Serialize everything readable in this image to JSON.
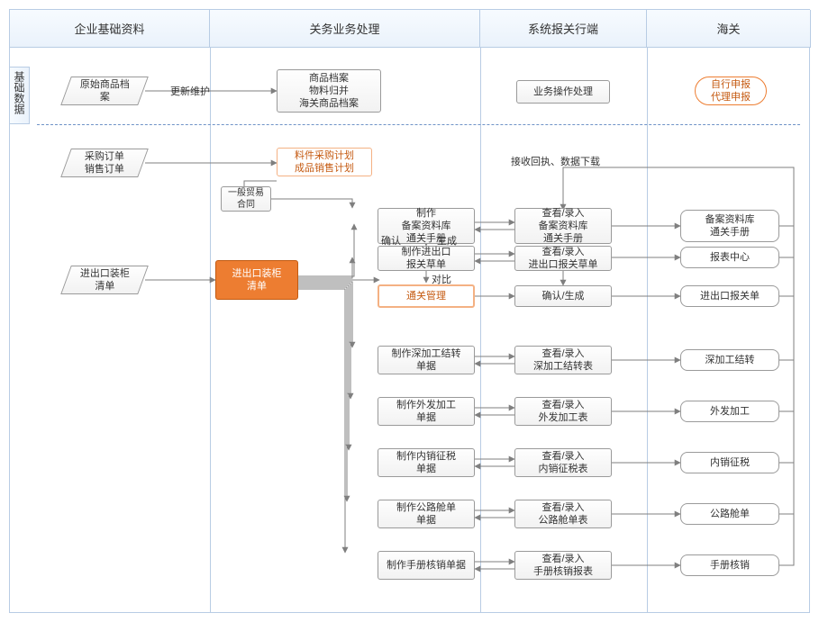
{
  "columns": [
    "企业基础资料",
    "关务业务处理",
    "系统报关行端",
    "海关"
  ],
  "row_label": "基础数据",
  "dash_note": "",
  "nodes": {
    "p_raw": "原始商品档\n案",
    "p_orders": "采购订单\n销售订单",
    "p_cont": "进出口装柜\n清单",
    "l_update": "更新维护",
    "b_archive": "商品档案\n物料归并\n海关商品档案",
    "b_ops": "业务操作处理",
    "pill": "自行申报\n代理申报",
    "o_plan": "料件采购计划\n成品销售计划",
    "b_trade": "一般贸易\n合同",
    "l_confirm": "确认",
    "l_gen": "生成",
    "l_compare": "对比",
    "l_recv": "接收回执、数据下载",
    "o_list": "进出口装柜\n清单",
    "m1": "制作\n备案资料库\n通关手册",
    "o_mg": "通关管理",
    "m2": "制作进出口\n报关草单",
    "m3": "制作深加工结转\n单据",
    "m4": "制作外发加工\n单据",
    "m5": "制作内销征税\n单据",
    "m6": "制作公路舱单\n单据",
    "m7": "制作手册核销单据",
    "r1": "查看/录入\n备案资料库\n通关手册",
    "r2": "查看/录入\n进出口报关草单",
    "r2b": "确认/生成",
    "r3": "查看/录入\n深加工结转表",
    "r4": "查看/录入\n外发加工表",
    "r5": "查看/录入\n内销征税表",
    "r6": "查看/录入\n公路舱单表",
    "r7": "查看/录入\n手册核销报表",
    "h1": "备案资料库\n通关手册",
    "h2": "报表中心",
    "h3": "进出口报关单",
    "h4": "深加工结转",
    "h5": "外发加工",
    "h6": "内销征税",
    "h7": "公路舱单",
    "h8": "手册核销"
  }
}
